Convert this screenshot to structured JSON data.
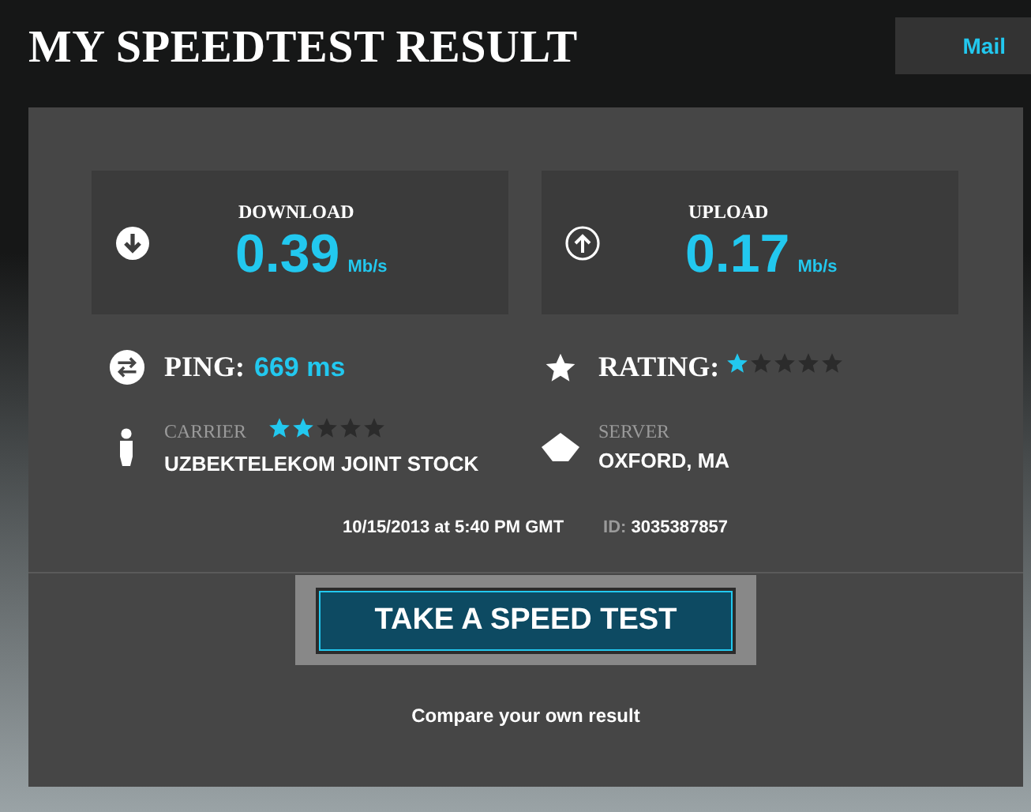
{
  "title": "MY SPEEDTEST RESULT",
  "nav": {
    "label": "Mail"
  },
  "metrics": [
    {
      "kind": "download",
      "label": "DOWNLOAD",
      "value": "0.39",
      "unit": "Mb/s"
    },
    {
      "kind": "upload",
      "label": "UPLOAD",
      "value": "0.17",
      "unit": "Mb/s"
    }
  ],
  "ping": {
    "label": "PING:",
    "value": "669 ms"
  },
  "rating": {
    "label": "RATING:",
    "stars": 1
  },
  "carrier": {
    "label": "CARRIER",
    "stars": 2,
    "name": "UZBEKTELEKOM JOINT STOCK"
  },
  "server": {
    "label": "SERVER",
    "name": "OXFORD, MA"
  },
  "timestamp": "10/15/2013 at 5:40 PM GMT",
  "result_id": {
    "label": "ID:",
    "value": "3035387857"
  },
  "button": "TAKE A SPEED TEST",
  "compare_link": "Compare your own result"
}
